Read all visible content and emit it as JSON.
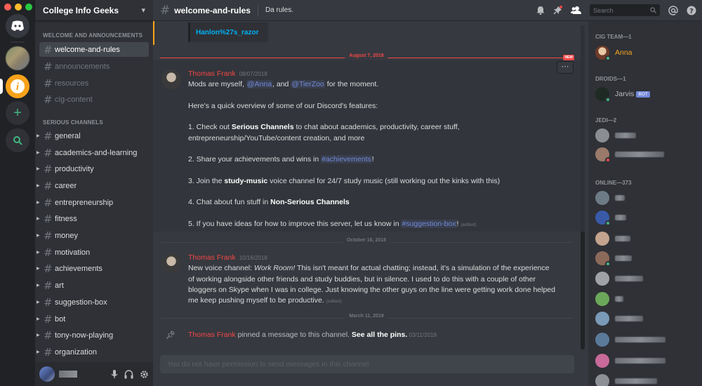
{
  "window": {
    "traffic_lights": [
      "#ff5f57",
      "#ffbd2e",
      "#28c940"
    ]
  },
  "server": {
    "name": "College Info Geeks"
  },
  "sidebar": {
    "categories": [
      "WELCOME AND ANNOUNCEMENTS",
      "SERIOUS CHANNELS"
    ],
    "welcome_channels": [
      "welcome-and-rules",
      "announcements",
      "resources",
      "cig-content"
    ],
    "serious_channels": [
      "general",
      "academics-and-learning",
      "productivity",
      "career",
      "entrepreneurship",
      "fitness",
      "money",
      "motivation",
      "achievements",
      "art",
      "suggestion-box",
      "bot",
      "tony-now-playing",
      "organization"
    ]
  },
  "header": {
    "channel": "welcome-and-rules",
    "topic": "Da rules.",
    "search_placeholder": "Search"
  },
  "messages": {
    "embed_link": "Hanlon%27s_razor",
    "divider_1": "August 7, 2018",
    "new_badge": "NEW",
    "msg1": {
      "author": "Thomas Frank",
      "time": "08/07/2018",
      "l1a": "Mods are myself, ",
      "l1_m1": "@Anna",
      "l1b": ", and ",
      "l1_m2": "@TierZoo",
      "l1c": " for the moment.",
      "l2": "Here's a quick overview of some of our Discord's features:",
      "l3a": "1. Check out ",
      "l3b": "Serious Channels",
      "l3c": " to chat about academics, productivity, career stuff,",
      "l4": "entrepreneurship/YouTube/content creation, and more",
      "l5a": "2. Share your achievements and wins in ",
      "l5_m": "#achievements",
      "l5b": "!",
      "l6a": "3. Join the ",
      "l6b": "study-music",
      "l6c": " voice channel for 24/7 study music (still working out the kinks with this)",
      "l7a": "4. Chat about fun stuff in ",
      "l7b": "Non-Serious Channels",
      "l8a": "5. If you have ideas for how to improve this server, let us know in ",
      "l8_m": "#suggestion-box",
      "l8b": "! ",
      "edited": "(edited)"
    },
    "divider_2": "October 16, 2018",
    "msg2": {
      "author": "Thomas Frank",
      "time": "10/16/2018",
      "l1a": "New voice channel: ",
      "l1b": "Work Room!",
      "l1c": " This isn't meant for actual chatting; instead, it's a simulation of the experience",
      "l2": "of working alongside other friends and study buddies, but in silence. I used to do this with a couple of other",
      "l3": "bloggers on Skype when I was in college. Just knowing the other guys on the line were getting work done helped",
      "l4a": "me keep pushing myself to be productive. ",
      "edited": "(edited)"
    },
    "divider_3": "March 11, 2019",
    "pin": {
      "author": "Thomas Frank",
      "text": " pinned a message to this channel. ",
      "link": "See all the pins.",
      "time": " 03/11/2019"
    },
    "composer_placeholder": "You do not have permission to send messages in this channel."
  },
  "member_list": {
    "groups": [
      "CIG TEAM—1",
      "DROIDS—1",
      "JEDI—2",
      "ONLINE—373"
    ],
    "anna": "Anna",
    "jarvis": "Jarvis",
    "bot_tag": "BOT",
    "colors": {
      "anna": "#f5a623",
      "mention": "#7289da",
      "author": "#f04747",
      "online": "#43b581"
    }
  },
  "icons": [
    "discord-logo",
    "plus-icon",
    "search-icon",
    "bell-icon",
    "pin-icon",
    "members-icon",
    "at-icon",
    "help-icon",
    "mic-icon",
    "headphones-icon",
    "gear-icon",
    "chevron-down-icon",
    "hash-icon"
  ]
}
